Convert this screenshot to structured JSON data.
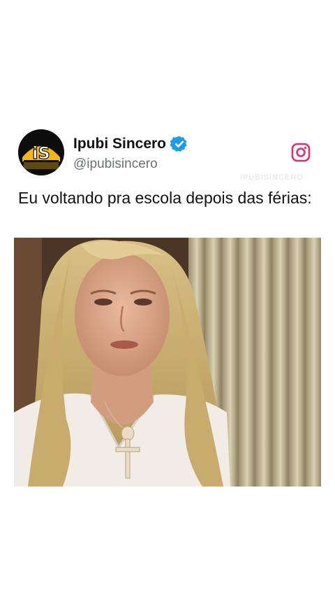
{
  "post": {
    "author": {
      "name": "Ipubi Sincero",
      "handle": "@ipubisincero",
      "verified": true,
      "avatar_text": "iS"
    },
    "platform_icon": "instagram-icon",
    "watermark": "IPUBISINCERO",
    "caption": "Eu voltando pra escola depois das férias:",
    "media": {
      "description_icon": "video-frame"
    }
  },
  "colors": {
    "background": "#ffffff",
    "verified_blue": "#1d9bf0",
    "instagram_pink": "#e1306c",
    "avatar_gold": "#f2b617",
    "text_primary": "#111111",
    "text_secondary": "#6b6f73"
  }
}
